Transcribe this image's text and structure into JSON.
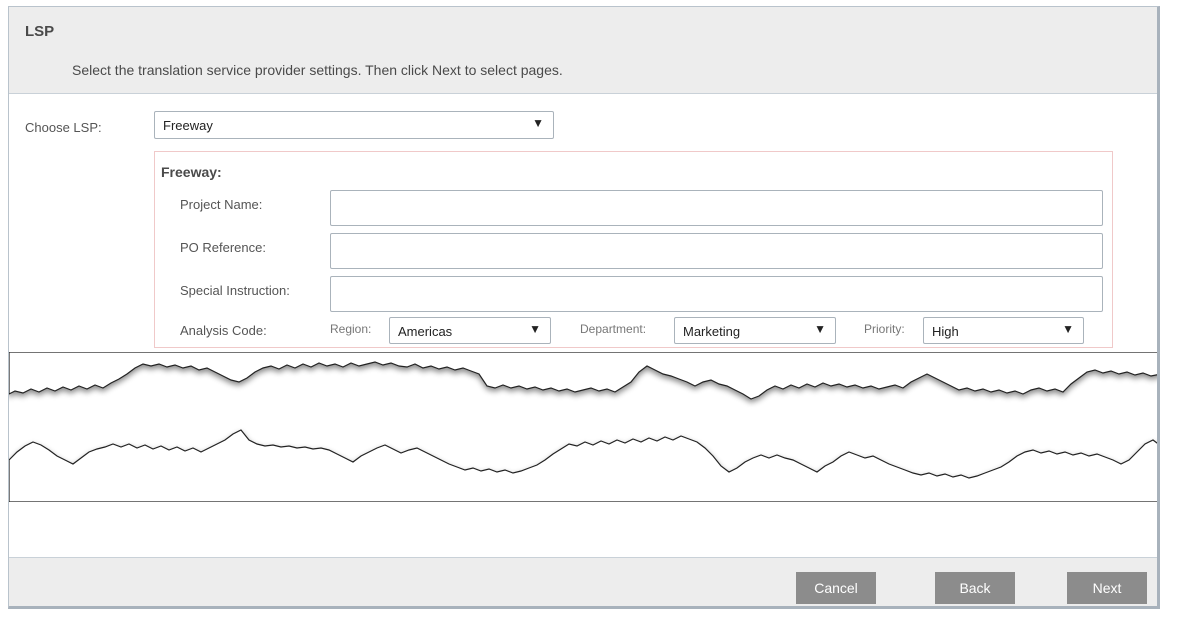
{
  "header": {
    "title": "LSP",
    "subtitle": "Select the translation service provider settings. Then click Next to select pages."
  },
  "choose_lsp": {
    "label": "Choose LSP:",
    "selected": "Freeway"
  },
  "freeway": {
    "title": "Freeway:",
    "project_name_label": "Project Name:",
    "project_name_value": "",
    "po_reference_label": "PO Reference:",
    "po_reference_value": "",
    "special_instruction_label": "Special Instruction:",
    "special_instruction_value": "",
    "analysis_code_label": "Analysis Code:",
    "region_label": "Region:",
    "region_value": "Americas",
    "department_label": "Department:",
    "department_value": "Marketing",
    "priority_label": "Priority:",
    "priority_value": "High"
  },
  "footer": {
    "cancel_label": "Cancel",
    "back_label": "Back",
    "next_label": "Next"
  },
  "icons": {
    "dropdown": "caret-down-icon"
  },
  "colors": {
    "button_bg": "#8c8c8c",
    "header_bg": "#ededed",
    "fieldset_border": "#f0c9c9"
  }
}
